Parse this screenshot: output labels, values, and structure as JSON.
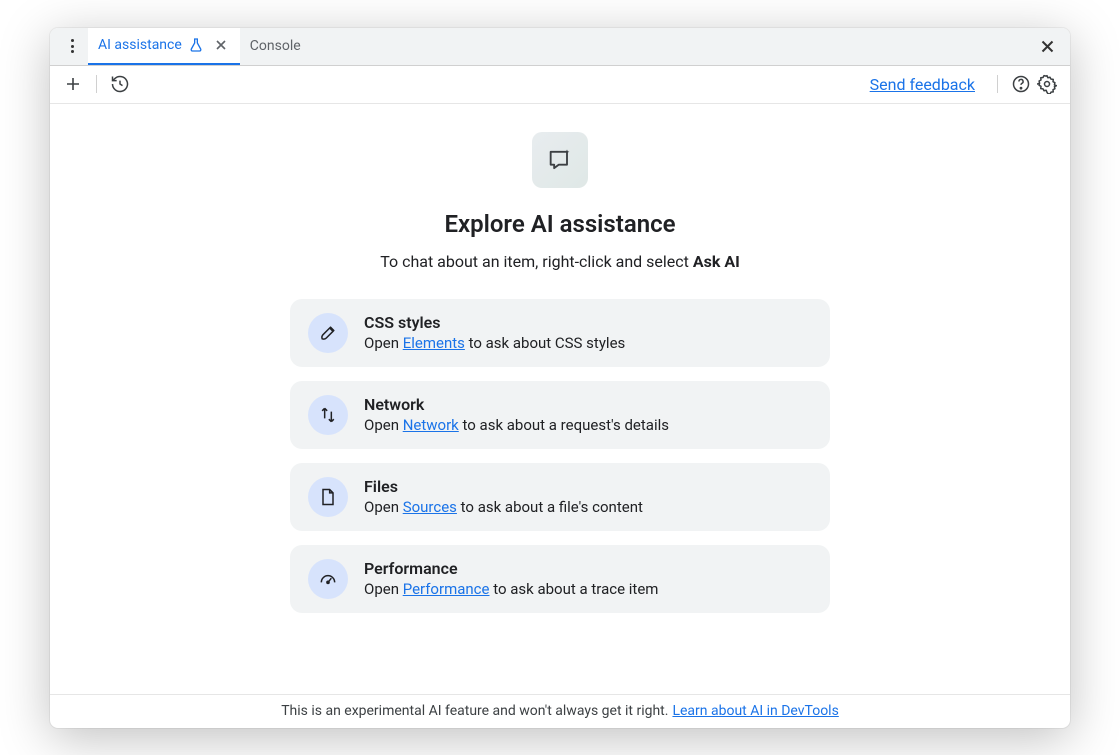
{
  "tabs": {
    "ai_assistance": "AI assistance",
    "console": "Console"
  },
  "toolbar": {
    "feedback": "Send feedback"
  },
  "hero": {
    "title": "Explore AI assistance",
    "sub_prefix": "To chat about an item, right-click and select ",
    "sub_bold": "Ask AI"
  },
  "cards": [
    {
      "title": "CSS styles",
      "desc_prefix": "Open ",
      "link": "Elements",
      "desc_suffix": " to ask about CSS styles"
    },
    {
      "title": "Network",
      "desc_prefix": "Open ",
      "link": "Network",
      "desc_suffix": " to ask about a request's details"
    },
    {
      "title": "Files",
      "desc_prefix": "Open ",
      "link": "Sources",
      "desc_suffix": " to ask about a file's content"
    },
    {
      "title": "Performance",
      "desc_prefix": "Open ",
      "link": "Performance",
      "desc_suffix": " to ask about a trace item"
    }
  ],
  "footer": {
    "text": "This is an experimental AI feature and won't always get it right.",
    "link": "Learn about AI in DevTools"
  }
}
